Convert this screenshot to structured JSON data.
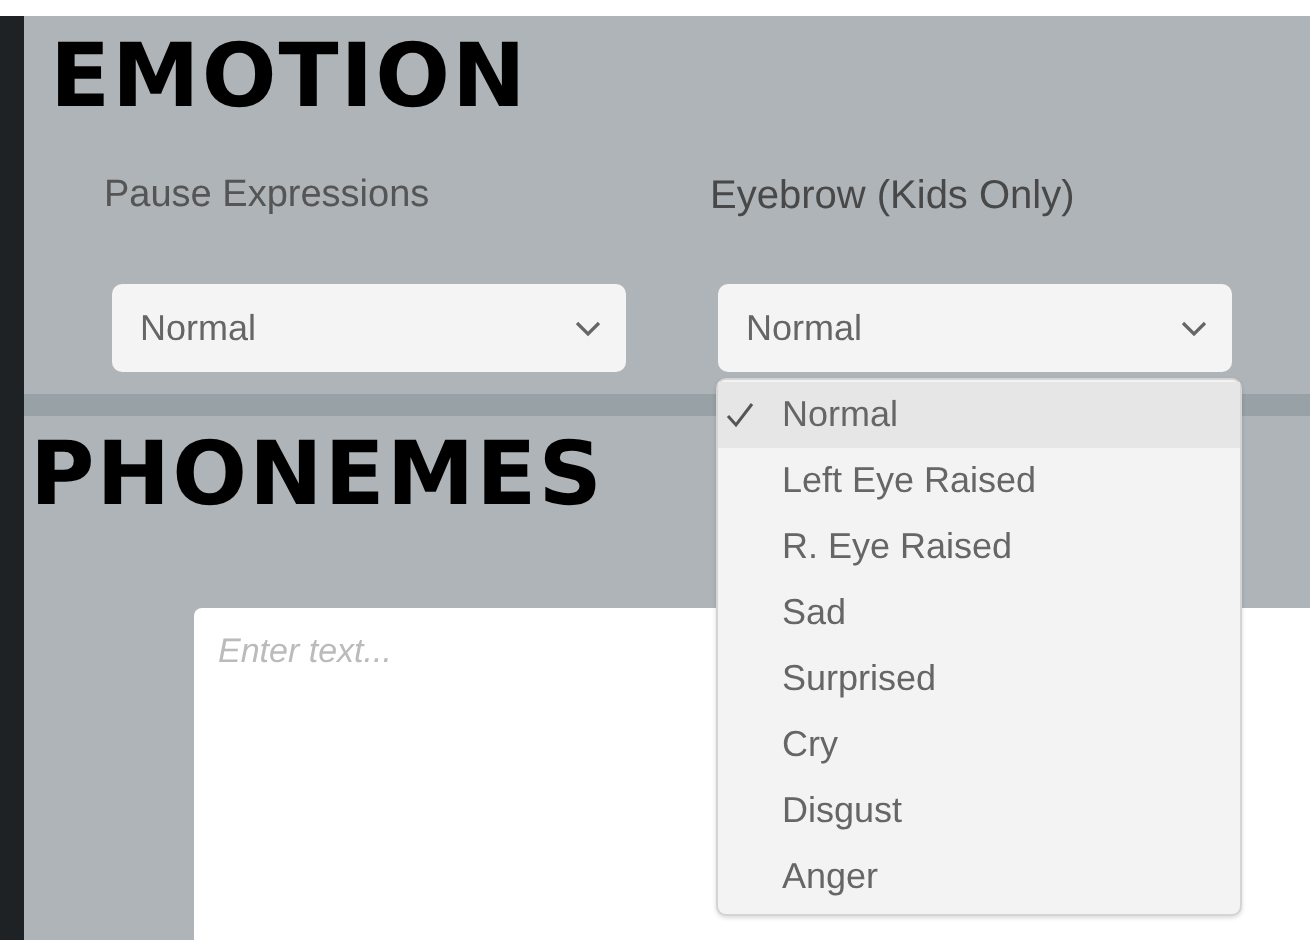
{
  "emotion": {
    "title": "EMOTION",
    "fields": [
      {
        "label": "Pause Expressions",
        "value": "Normal"
      },
      {
        "label": "Eyebrow (Kids Only)",
        "value": "Normal",
        "options": [
          {
            "label": "Normal",
            "selected": true
          },
          {
            "label": "Left Eye Raised",
            "selected": false
          },
          {
            "label": "R. Eye Raised",
            "selected": false
          },
          {
            "label": "Sad",
            "selected": false
          },
          {
            "label": "Surprised",
            "selected": false
          },
          {
            "label": "Cry",
            "selected": false
          },
          {
            "label": "Disgust",
            "selected": false
          },
          {
            "label": "Anger",
            "selected": false
          }
        ]
      }
    ]
  },
  "phonemes": {
    "title": "PHONEMES",
    "text": {
      "placeholder": "Enter text..."
    }
  }
}
